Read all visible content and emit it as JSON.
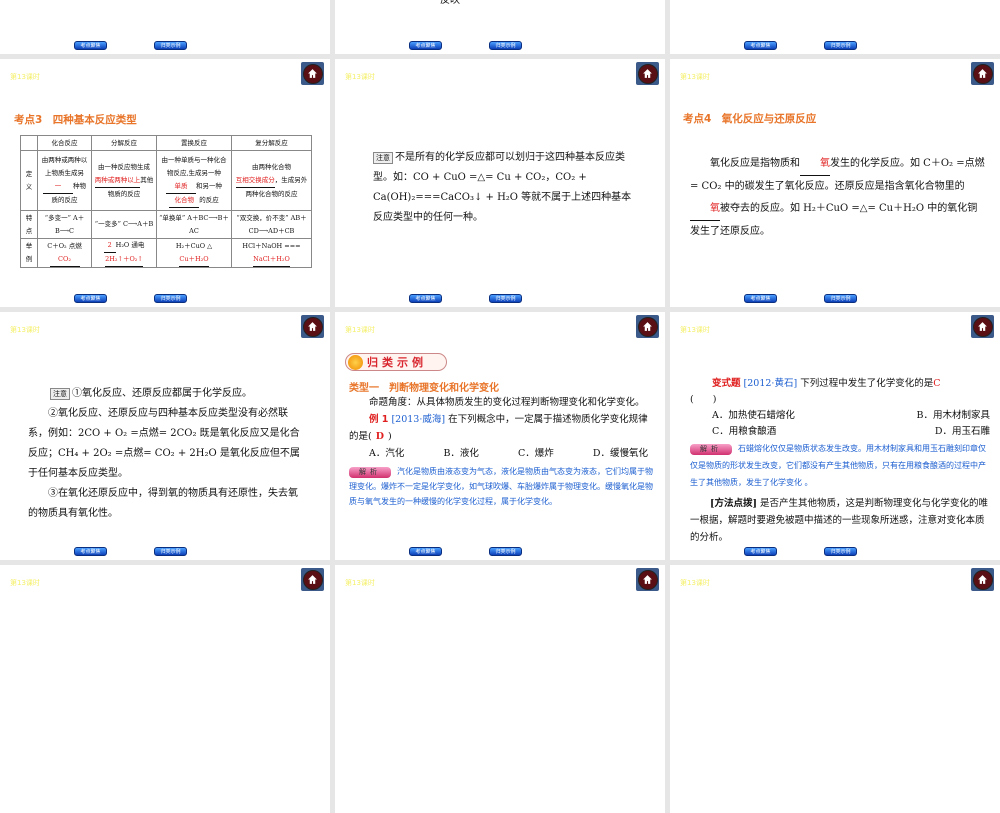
{
  "common": {
    "lesson": "第13课时",
    "nav_1": "考点聚焦",
    "nav_2": "归类示例"
  },
  "s1": {},
  "s2": {
    "tail": "反映"
  },
  "s4": {
    "title": "考点3　四种基本反应类型",
    "headers": [
      "",
      "化合反应",
      "分解反应",
      "置换反应",
      "复分解反应"
    ],
    "rows": [
      {
        "label": "定义",
        "c1a": "由两种或两种以上物质生成另",
        "c1b": "一",
        "c1c": "种物质的反应",
        "c2a": "由一种反应物生成",
        "c2b": "两种或两种以上",
        "c2c": "其他物质的反应",
        "c3a": "由一种单质与一种化合物反应,生成另一种",
        "c3b": "单质",
        "c3c": "和另一种",
        "c3d": "化合物",
        "c3e": "的反应",
        "c4a": "由两种化合物",
        "c4b": "互相交换成分",
        "c4c": "，生成另外两种化合物的反应"
      },
      {
        "label": "特点",
        "c1": "“多变一” A＋B⟶C",
        "c2": "“一变多” C⟶A＋B",
        "c3": "“单换单” A＋BC⟶B＋AC",
        "c4": "“双交换，价不变” AB＋CD⟶AD＋CB"
      },
      {
        "label": "举例",
        "c1a": "C＋O₂ 点燃",
        "c1b": "CO₂",
        "c2a": "2",
        "c2b": "H₂O 通电",
        "c2c": "2H₂↑＋O₂↑",
        "c3a": "H₂＋CuO △",
        "c3b": "Cu＋H₂O",
        "c4a": "HCl＋NaOH ===",
        "c4b": "NaCl＋H₂O"
      }
    ]
  },
  "s5": {
    "note": "注意",
    "text": "不是所有的化学反应都可以划归于这四种基本反应类型。如：CO + CuO =△= Cu + CO₂，CO₂ + Ca(OH)₂===CaCO₃↓ + H₂O 等就不属于上述四种基本反应类型中的任何一种。"
  },
  "s6": {
    "title": "考点4　氧化反应与还原反应",
    "p1": "氧化反应是指物质和",
    "b1": "氧",
    "p2": "发生的化学反应。如 C＋O₂ =点燃= CO₂ 中的碳发生了氧化反应。还原反应是指含氧化合物里的",
    "b2": "氧",
    "p3": "被夺去的反应。如 H₂＋CuO =△= Cu＋H₂O 中的氧化铜发生了还原反应。"
  },
  "s7": {
    "note": "注意",
    "l1": "①氧化反应、还原反应都属于化学反应。",
    "l2": "②氧化反应、还原反应与四种基本反应类型没有必然联系，例如：2CO + O₂ =点燃= 2CO₂ 既是氧化反应又是化合反应；CH₄ + 2O₂ =点燃= CO₂ + 2H₂O 是氧化反应但不属于任何基本反应类型。",
    "l3": "③在氧化还原反应中，得到氧的物质具有还原性，失去氧的物质具有氧化性。"
  },
  "s8": {
    "badge": "归类示例",
    "type": "类型一　判断物理变化和化学变化",
    "angle": "命题角度：从具体物质发生的变化过程判断物理变化和化学变化。",
    "ex": "例 1",
    "src": "[2013·威海]",
    "q": "在下列概念中，一定属于描述物质化学变化规律的是(",
    "ans": "D",
    "q_end": ")",
    "opts": [
      "A．汽化",
      "B．液化",
      "C．爆炸",
      "D．缓慢氧化"
    ],
    "jx": "解析",
    "analysis": "汽化是物质由液态变为气态，液化是物质由气态变为液态，它们均属于物理变化。爆炸不一定是化学变化，如气球吹爆、车胎爆炸属于物理变化。缓慢氧化是物质与氧气发生的一种缓慢的化学变化过程，属于化学变化。"
  },
  "s9": {
    "label": "变式题",
    "src": "[2012·黄石]",
    "q": "下列过程中发生了化学变化的是",
    "ans": "C",
    "paren": "(　　)",
    "opts": [
      "A．加热使石蜡熔化",
      "B．用木材制家具",
      "C．用粮食酿酒",
      "D．用玉石雕"
    ],
    "jx": "解析",
    "analysis": "石蜡熔化仅仅是物质状态发生改变。用木材制家具和用玉石雕刻印章仅仅是物质的形状发生改变，它们都没有产生其他物质，只有在用粮食酿酒的过程中产生了其他物质，发生了化学变化 。",
    "tip_label": "[方法点拨]",
    "tip": "是否产生其他物质，这是判断物理变化与化学变化的唯一根据，解题时要避免被题中描述的一些现象所迷惑，注意对变化本质的分析。"
  }
}
